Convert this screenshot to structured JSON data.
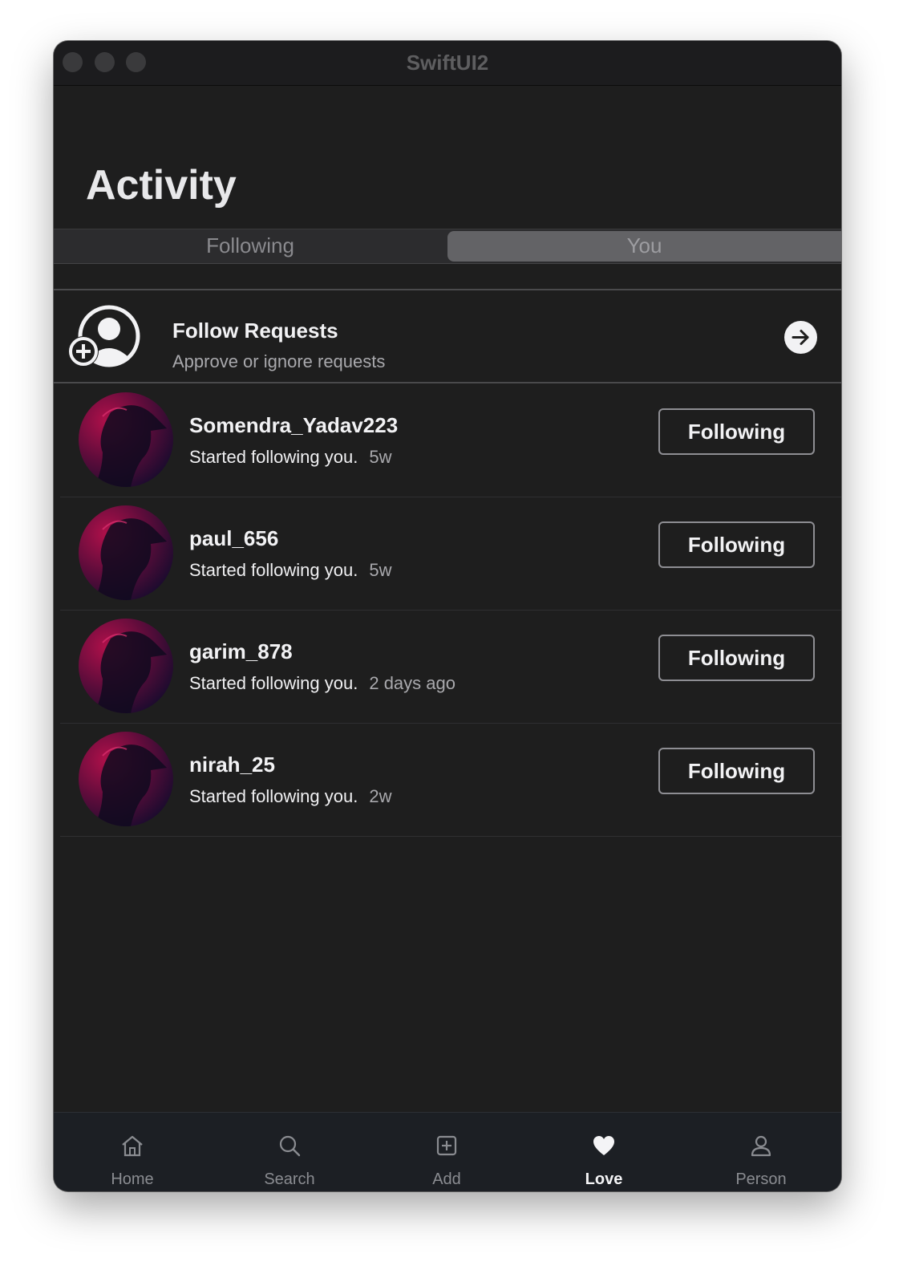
{
  "window": {
    "title": "SwiftUI2"
  },
  "page": {
    "title": "Activity"
  },
  "segments": {
    "following": "Following",
    "you": "You",
    "selected": "You"
  },
  "follow_requests": {
    "title": "Follow Requests",
    "subtitle": "Approve or ignore requests",
    "icon": "person-add-icon",
    "action_icon": "arrow-right-circle-icon"
  },
  "activity": [
    {
      "username": "Somendra_Yadav223",
      "message": "Started following you.",
      "time": "5w",
      "button": "Following"
    },
    {
      "username": "paul_656",
      "message": "Started following you.",
      "time": "5w",
      "button": "Following"
    },
    {
      "username": "garim_878",
      "message": "Started following you.",
      "time": "2 days ago",
      "button": "Following"
    },
    {
      "username": "nirah_25",
      "message": "Started following you.",
      "time": "2w",
      "button": "Following"
    }
  ],
  "tabbar": {
    "items": [
      {
        "label": "Home",
        "icon": "house-icon",
        "active": false
      },
      {
        "label": "Search",
        "icon": "magnifier-icon",
        "active": false
      },
      {
        "label": "Add",
        "icon": "plus-square-icon",
        "active": false
      },
      {
        "label": "Love",
        "icon": "heart-icon",
        "active": true
      },
      {
        "label": "Person",
        "icon": "person-icon",
        "active": false
      }
    ]
  },
  "colors": {
    "background": "#1e1e1e",
    "selected_segment": "#636366",
    "text_primary": "#f2f2f4",
    "text_secondary": "#a9a9ad"
  }
}
